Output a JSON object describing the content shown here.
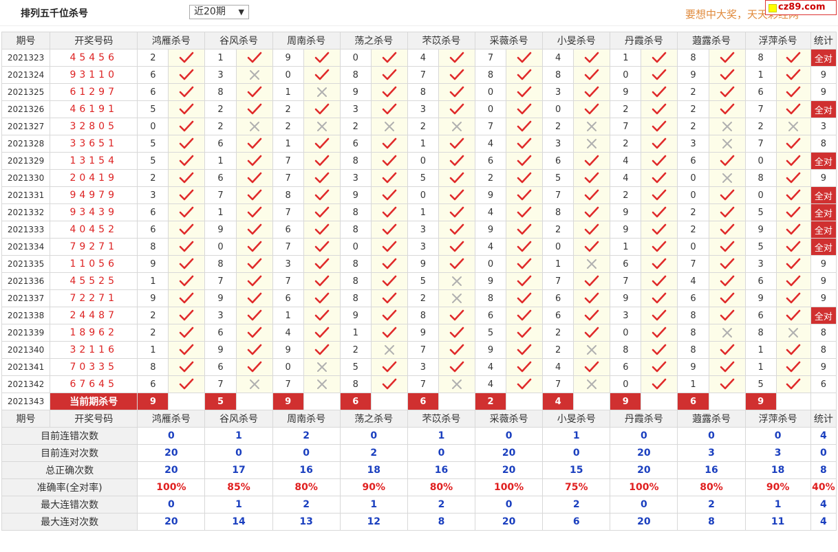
{
  "page": {
    "title": "排列五千位杀号",
    "range_select": "近20期",
    "slogan": "要想中大奖，天天彩经网",
    "logo": "cz89.com"
  },
  "table": {
    "headers": [
      "期号",
      "开奖号码",
      "鸿雁杀号",
      "谷风杀号",
      "周南杀号",
      "荡之杀号",
      "芣苡杀号",
      "采薇杀号",
      "小旻杀号",
      "丹霞杀号",
      "蕸露杀号",
      "浮萍杀号",
      "统计"
    ],
    "all_correct_label": "全对",
    "rows": [
      {
        "period": "2021323",
        "draw": "45456",
        "kills": [
          [
            2,
            1
          ],
          [
            1,
            1
          ],
          [
            9,
            1
          ],
          [
            0,
            1
          ],
          [
            4,
            1
          ],
          [
            7,
            1
          ],
          [
            4,
            1
          ],
          [
            1,
            1
          ],
          [
            8,
            1
          ],
          [
            8,
            1
          ]
        ],
        "stat": "全对"
      },
      {
        "period": "2021324",
        "draw": "93110",
        "kills": [
          [
            6,
            1
          ],
          [
            3,
            0
          ],
          [
            0,
            1
          ],
          [
            8,
            1
          ],
          [
            7,
            1
          ],
          [
            8,
            1
          ],
          [
            8,
            1
          ],
          [
            0,
            1
          ],
          [
            9,
            1
          ],
          [
            1,
            1
          ]
        ],
        "stat": "9"
      },
      {
        "period": "2021325",
        "draw": "61297",
        "kills": [
          [
            6,
            1
          ],
          [
            8,
            1
          ],
          [
            1,
            0
          ],
          [
            9,
            1
          ],
          [
            8,
            1
          ],
          [
            0,
            1
          ],
          [
            3,
            1
          ],
          [
            9,
            1
          ],
          [
            2,
            1
          ],
          [
            6,
            1
          ]
        ],
        "stat": "9"
      },
      {
        "period": "2021326",
        "draw": "46191",
        "kills": [
          [
            5,
            1
          ],
          [
            2,
            1
          ],
          [
            2,
            1
          ],
          [
            3,
            1
          ],
          [
            3,
            1
          ],
          [
            0,
            1
          ],
          [
            0,
            1
          ],
          [
            2,
            1
          ],
          [
            2,
            1
          ],
          [
            7,
            1
          ]
        ],
        "stat": "全对"
      },
      {
        "period": "2021327",
        "draw": "32805",
        "kills": [
          [
            0,
            1
          ],
          [
            2,
            0
          ],
          [
            2,
            0
          ],
          [
            2,
            0
          ],
          [
            2,
            0
          ],
          [
            7,
            1
          ],
          [
            2,
            0
          ],
          [
            7,
            1
          ],
          [
            2,
            0
          ],
          [
            2,
            0
          ]
        ],
        "stat": "3"
      },
      {
        "period": "2021328",
        "draw": "33651",
        "kills": [
          [
            5,
            1
          ],
          [
            6,
            1
          ],
          [
            1,
            1
          ],
          [
            6,
            1
          ],
          [
            1,
            1
          ],
          [
            4,
            1
          ],
          [
            3,
            0
          ],
          [
            2,
            1
          ],
          [
            3,
            0
          ],
          [
            7,
            1
          ]
        ],
        "stat": "8"
      },
      {
        "period": "2021329",
        "draw": "13154",
        "kills": [
          [
            5,
            1
          ],
          [
            1,
            1
          ],
          [
            7,
            1
          ],
          [
            8,
            1
          ],
          [
            0,
            1
          ],
          [
            6,
            1
          ],
          [
            6,
            1
          ],
          [
            4,
            1
          ],
          [
            6,
            1
          ],
          [
            0,
            1
          ]
        ],
        "stat": "全对"
      },
      {
        "period": "2021330",
        "draw": "20419",
        "kills": [
          [
            2,
            1
          ],
          [
            6,
            1
          ],
          [
            7,
            1
          ],
          [
            3,
            1
          ],
          [
            5,
            1
          ],
          [
            2,
            1
          ],
          [
            5,
            1
          ],
          [
            4,
            1
          ],
          [
            0,
            0
          ],
          [
            8,
            1
          ]
        ],
        "stat": "9"
      },
      {
        "period": "2021331",
        "draw": "94979",
        "kills": [
          [
            3,
            1
          ],
          [
            7,
            1
          ],
          [
            8,
            1
          ],
          [
            9,
            1
          ],
          [
            0,
            1
          ],
          [
            9,
            1
          ],
          [
            7,
            1
          ],
          [
            2,
            1
          ],
          [
            0,
            1
          ],
          [
            0,
            1
          ]
        ],
        "stat": "全对"
      },
      {
        "period": "2021332",
        "draw": "93439",
        "kills": [
          [
            6,
            1
          ],
          [
            1,
            1
          ],
          [
            7,
            1
          ],
          [
            8,
            1
          ],
          [
            1,
            1
          ],
          [
            4,
            1
          ],
          [
            8,
            1
          ],
          [
            9,
            1
          ],
          [
            2,
            1
          ],
          [
            5,
            1
          ]
        ],
        "stat": "全对"
      },
      {
        "period": "2021333",
        "draw": "40452",
        "kills": [
          [
            6,
            1
          ],
          [
            9,
            1
          ],
          [
            6,
            1
          ],
          [
            8,
            1
          ],
          [
            3,
            1
          ],
          [
            9,
            1
          ],
          [
            2,
            1
          ],
          [
            9,
            1
          ],
          [
            2,
            1
          ],
          [
            9,
            1
          ]
        ],
        "stat": "全对"
      },
      {
        "period": "2021334",
        "draw": "79271",
        "kills": [
          [
            8,
            1
          ],
          [
            0,
            1
          ],
          [
            7,
            1
          ],
          [
            0,
            1
          ],
          [
            3,
            1
          ],
          [
            4,
            1
          ],
          [
            0,
            1
          ],
          [
            1,
            1
          ],
          [
            0,
            1
          ],
          [
            5,
            1
          ]
        ],
        "stat": "全对"
      },
      {
        "period": "2021335",
        "draw": "11056",
        "kills": [
          [
            9,
            1
          ],
          [
            8,
            1
          ],
          [
            3,
            1
          ],
          [
            8,
            1
          ],
          [
            9,
            1
          ],
          [
            0,
            1
          ],
          [
            1,
            0
          ],
          [
            6,
            1
          ],
          [
            7,
            1
          ],
          [
            3,
            1
          ]
        ],
        "stat": "9"
      },
      {
        "period": "2021336",
        "draw": "45525",
        "kills": [
          [
            1,
            1
          ],
          [
            7,
            1
          ],
          [
            7,
            1
          ],
          [
            8,
            1
          ],
          [
            5,
            0
          ],
          [
            9,
            1
          ],
          [
            7,
            1
          ],
          [
            7,
            1
          ],
          [
            4,
            1
          ],
          [
            6,
            1
          ]
        ],
        "stat": "9"
      },
      {
        "period": "2021337",
        "draw": "72271",
        "kills": [
          [
            9,
            1
          ],
          [
            9,
            1
          ],
          [
            6,
            1
          ],
          [
            8,
            1
          ],
          [
            2,
            0
          ],
          [
            8,
            1
          ],
          [
            6,
            1
          ],
          [
            9,
            1
          ],
          [
            6,
            1
          ],
          [
            9,
            1
          ]
        ],
        "stat": "9"
      },
      {
        "period": "2021338",
        "draw": "24487",
        "kills": [
          [
            2,
            1
          ],
          [
            3,
            1
          ],
          [
            1,
            1
          ],
          [
            9,
            1
          ],
          [
            8,
            1
          ],
          [
            6,
            1
          ],
          [
            6,
            1
          ],
          [
            3,
            1
          ],
          [
            8,
            1
          ],
          [
            6,
            1
          ]
        ],
        "stat": "全对"
      },
      {
        "period": "2021339",
        "draw": "18962",
        "kills": [
          [
            2,
            1
          ],
          [
            6,
            1
          ],
          [
            4,
            1
          ],
          [
            1,
            1
          ],
          [
            9,
            1
          ],
          [
            5,
            1
          ],
          [
            2,
            1
          ],
          [
            0,
            1
          ],
          [
            8,
            0
          ],
          [
            8,
            0
          ]
        ],
        "stat": "8"
      },
      {
        "period": "2021340",
        "draw": "32116",
        "kills": [
          [
            1,
            1
          ],
          [
            9,
            1
          ],
          [
            9,
            1
          ],
          [
            2,
            0
          ],
          [
            7,
            1
          ],
          [
            9,
            1
          ],
          [
            2,
            0
          ],
          [
            8,
            1
          ],
          [
            8,
            1
          ],
          [
            1,
            1
          ]
        ],
        "stat": "8"
      },
      {
        "period": "2021341",
        "draw": "70335",
        "kills": [
          [
            8,
            1
          ],
          [
            6,
            1
          ],
          [
            0,
            0
          ],
          [
            5,
            1
          ],
          [
            3,
            1
          ],
          [
            4,
            1
          ],
          [
            4,
            1
          ],
          [
            6,
            1
          ],
          [
            9,
            1
          ],
          [
            1,
            1
          ]
        ],
        "stat": "9"
      },
      {
        "period": "2021342",
        "draw": "67645",
        "kills": [
          [
            6,
            1
          ],
          [
            7,
            0
          ],
          [
            7,
            0
          ],
          [
            8,
            1
          ],
          [
            7,
            0
          ],
          [
            4,
            1
          ],
          [
            7,
            0
          ],
          [
            0,
            1
          ],
          [
            1,
            1
          ],
          [
            5,
            1
          ]
        ],
        "stat": "6"
      }
    ],
    "current": {
      "period": "2021343",
      "label": "当前期杀号",
      "values": [
        "9",
        "5",
        "9",
        "6",
        "6",
        "2",
        "4",
        "9",
        "6",
        "9"
      ]
    },
    "stats": [
      {
        "label": "目前连错次数",
        "values": [
          "0",
          "1",
          "2",
          "0",
          "1",
          "0",
          "1",
          "0",
          "0",
          "0"
        ],
        "total": "4",
        "style": "blue"
      },
      {
        "label": "目前连对次数",
        "values": [
          "20",
          "0",
          "0",
          "2",
          "0",
          "20",
          "0",
          "20",
          "3",
          "3"
        ],
        "total": "0",
        "style": "blue"
      },
      {
        "label": "总正确次数",
        "values": [
          "20",
          "17",
          "16",
          "18",
          "16",
          "20",
          "15",
          "20",
          "16",
          "18"
        ],
        "total": "8",
        "style": "blue"
      },
      {
        "label": "准确率(全对率)",
        "values": [
          "100%",
          "85%",
          "80%",
          "90%",
          "80%",
          "100%",
          "75%",
          "100%",
          "80%",
          "90%"
        ],
        "total": "40%",
        "style": "red"
      },
      {
        "label": "最大连错次数",
        "values": [
          "0",
          "1",
          "2",
          "1",
          "2",
          "0",
          "2",
          "0",
          "2",
          "1"
        ],
        "total": "4",
        "style": "blue"
      },
      {
        "label": "最大连对次数",
        "values": [
          "20",
          "14",
          "13",
          "12",
          "8",
          "20",
          "6",
          "20",
          "8",
          "11"
        ],
        "total": "4",
        "style": "blue"
      }
    ]
  },
  "colors": {
    "accent_red": "#d03030",
    "check_red": "#e02a2a",
    "cross_gray": "#b0b0b0",
    "stat_blue": "#1a3fbf"
  }
}
